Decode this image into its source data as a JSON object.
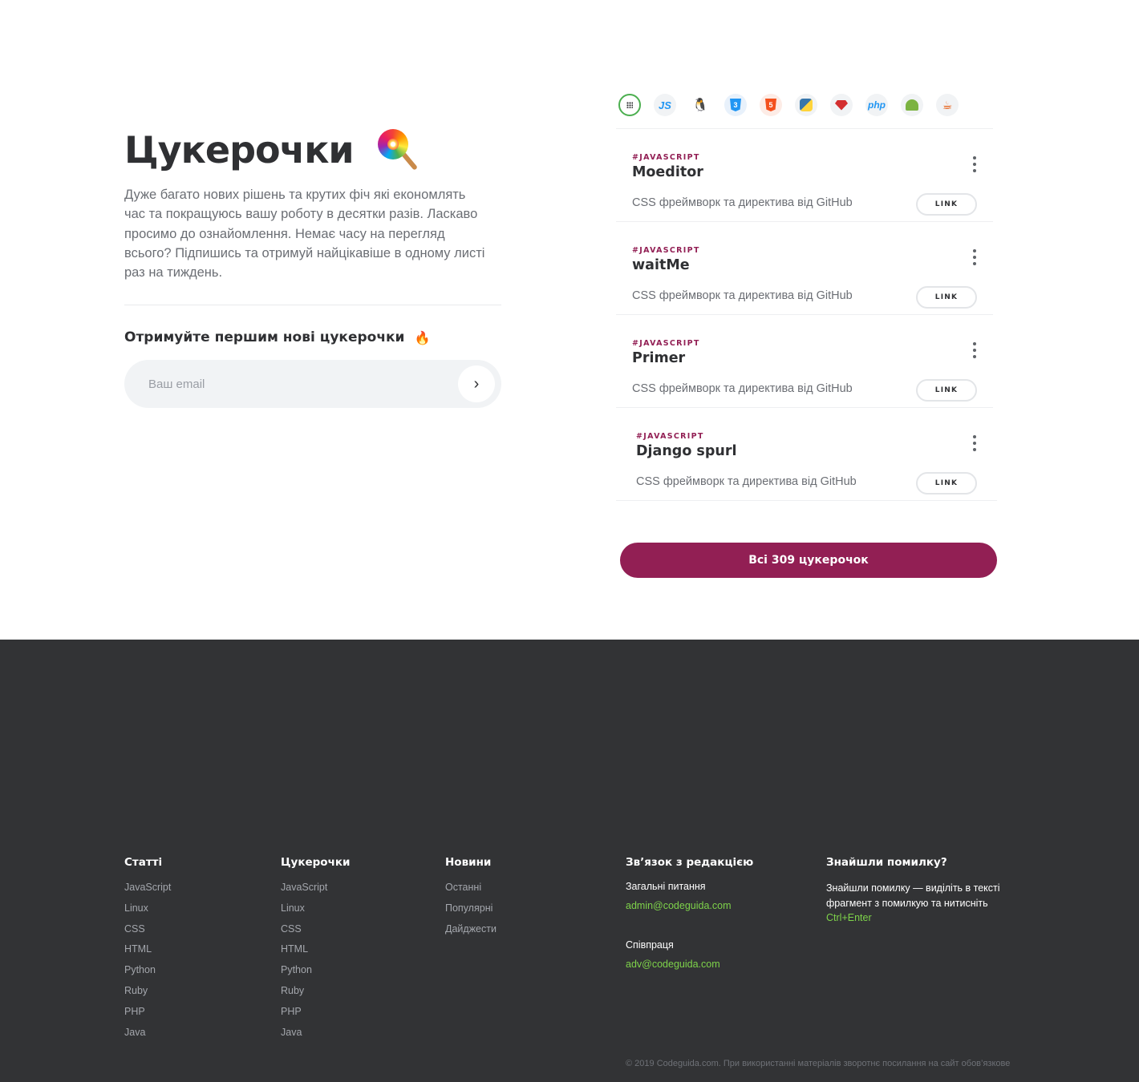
{
  "hero": {
    "title": "Цукерочки",
    "description": "Дуже багато нових рішень та крутих фіч які економлять час та покращуюсь вашу роботу в десятки разів. Ласкаво просимо до ознайомлення. Немає часу на перегляд всього? Підпишись та отримуй найцікавіше в одному листі раз на тиждень.",
    "subscribe_title": "Отримуйте першим нові цукерочки",
    "email_placeholder": "Ваш email",
    "submit_glyph": "›"
  },
  "filters": [
    {
      "name": "all",
      "label": ""
    },
    {
      "name": "javascript",
      "label": "JS"
    },
    {
      "name": "linux",
      "label": "🐧"
    },
    {
      "name": "css",
      "label": "3"
    },
    {
      "name": "html",
      "label": "5"
    },
    {
      "name": "python",
      "label": ""
    },
    {
      "name": "ruby",
      "label": ""
    },
    {
      "name": "php",
      "label": "php"
    },
    {
      "name": "android",
      "label": ""
    },
    {
      "name": "java",
      "label": "☕"
    }
  ],
  "cards": [
    {
      "tag": "#JAVASCRIPT",
      "title": "Moeditor",
      "description": "CSS фреймворк та директива від GitHub",
      "link_label": "LINK"
    },
    {
      "tag": "#JAVASCRIPT",
      "title": "waitMe",
      "description": "CSS фреймворк та директива від GitHub",
      "link_label": "LINK"
    },
    {
      "tag": "#JAVASCRIPT",
      "title": "Primer",
      "description": "CSS фреймворк та директива від GitHub",
      "link_label": "LINK"
    },
    {
      "tag": "#JAVASCRIPT",
      "title": "Django spurl",
      "description": "CSS фреймворк та директива від GitHub",
      "link_label": "LINK"
    }
  ],
  "all_button_label": "Всі 309 цукерочок",
  "footer": {
    "articles": {
      "title": "Статті",
      "items": [
        "JavaScript",
        "Linux",
        "CSS",
        "HTML",
        "Python",
        "Ruby",
        "PHP",
        "Java"
      ]
    },
    "candies": {
      "title": "Цукерочки",
      "items": [
        "JavaScript",
        "Linux",
        "CSS",
        "HTML",
        "Python",
        "Ruby",
        "PHP",
        "Java"
      ]
    },
    "news": {
      "title": "Новини",
      "items": [
        "Останні",
        "Популярні",
        "Дайджести"
      ]
    },
    "contact": {
      "title": "Зв’язок з редакцією",
      "general_label": "Загальні питання",
      "general_email": "admin@codeguida.com",
      "partner_label": "Співпраця",
      "partner_email": "adv@codeguida.com"
    },
    "error": {
      "title": "Знайшли помилку?",
      "text": "Знайшли помилку — виділіть в тексті фрагмент з помилкую та нитисніть",
      "shortcut": "Ctrl+Enter"
    },
    "copyright": "© 2019 Codeguida.com. При використанні матеріалів зворотнє посилання на сайт обов’язкове"
  },
  "colors": {
    "accent": "#921f54",
    "footer_bg": "#323335",
    "link_green": "#7ed34a",
    "active_filter": "#4caf50"
  }
}
